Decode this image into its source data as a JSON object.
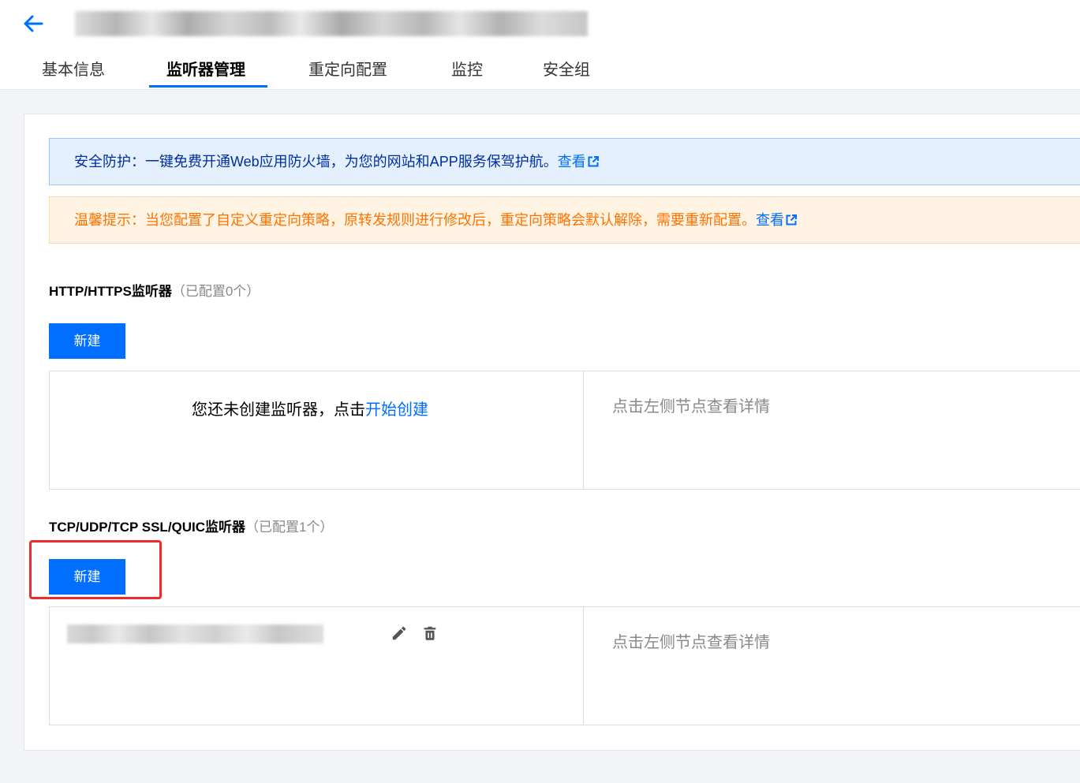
{
  "tabs": [
    {
      "label": "基本信息",
      "active": false
    },
    {
      "label": "监听器管理",
      "active": true
    },
    {
      "label": "重定向配置",
      "active": false
    },
    {
      "label": "监控",
      "active": false
    },
    {
      "label": "安全组",
      "active": false
    }
  ],
  "alerts": {
    "info": {
      "text": "安全防护：一键免费开通Web应用防火墙，为您的网站和APP服务保驾护航。",
      "link": "查看"
    },
    "warn": {
      "text": "温馨提示：当您配置了自定义重定向策略，原转发规则进行修改后，重定向策略会默认解除，需要重新配置。",
      "link": "查看"
    }
  },
  "http_section": {
    "title": "HTTP/HTTPS监听器",
    "count": "（已配置0个）",
    "new_label": "新建",
    "empty_text": "您还未创建监听器，点击",
    "empty_link": "开始创建",
    "detail_hint": "点击左侧节点查看详情"
  },
  "tcp_section": {
    "title": "TCP/UDP/TCP SSL/QUIC监听器",
    "count": "（已配置1个）",
    "new_label": "新建",
    "detail_hint": "点击左侧节点查看详情"
  },
  "colors": {
    "primary": "#006eff",
    "highlight": "#ee2a2a",
    "warn_text": "#ff7200"
  },
  "icons": [
    "back-arrow-icon",
    "external-link-icon",
    "edit-pencil-icon",
    "delete-trash-icon"
  ]
}
